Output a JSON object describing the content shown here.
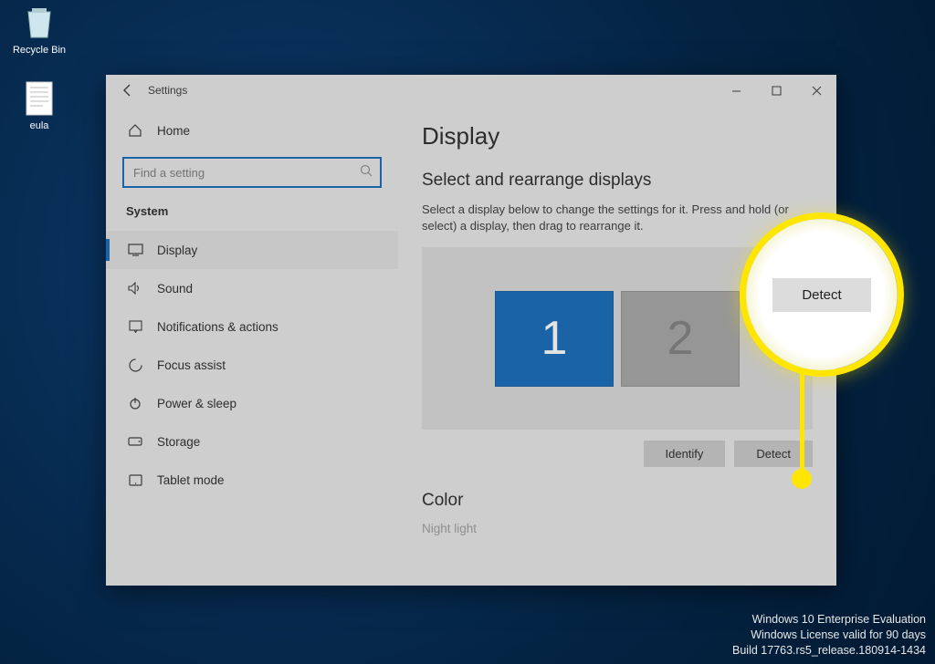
{
  "desktop": {
    "icons": [
      {
        "label": "Recycle Bin"
      },
      {
        "label": "eula"
      }
    ]
  },
  "window": {
    "title": "Settings",
    "controls": {
      "min": "▁",
      "max": "▢",
      "close": "✕"
    }
  },
  "sidebar": {
    "home": "Home",
    "search_placeholder": "Find a setting",
    "section": "System",
    "items": [
      {
        "label": "Display",
        "icon": "display"
      },
      {
        "label": "Sound",
        "icon": "sound"
      },
      {
        "label": "Notifications & actions",
        "icon": "notifications"
      },
      {
        "label": "Focus assist",
        "icon": "focus"
      },
      {
        "label": "Power & sleep",
        "icon": "power"
      },
      {
        "label": "Storage",
        "icon": "storage"
      },
      {
        "label": "Tablet mode",
        "icon": "tablet"
      }
    ]
  },
  "content": {
    "heading": "Display",
    "sub1": "Select and rearrange displays",
    "desc": "Select a display below to change the settings for it. Press and hold (or select) a display, then drag to rearrange it.",
    "monitor1": "1",
    "monitor2": "2",
    "identify": "Identify",
    "detect": "Detect",
    "sub2": "Color",
    "nightlight": "Night light"
  },
  "callout": {
    "label": "Detect"
  },
  "watermark": {
    "l1": "Windows 10 Enterprise Evaluation",
    "l2": "Windows License valid for 90 days",
    "l3": "Build 17763.rs5_release.180914-1434"
  }
}
